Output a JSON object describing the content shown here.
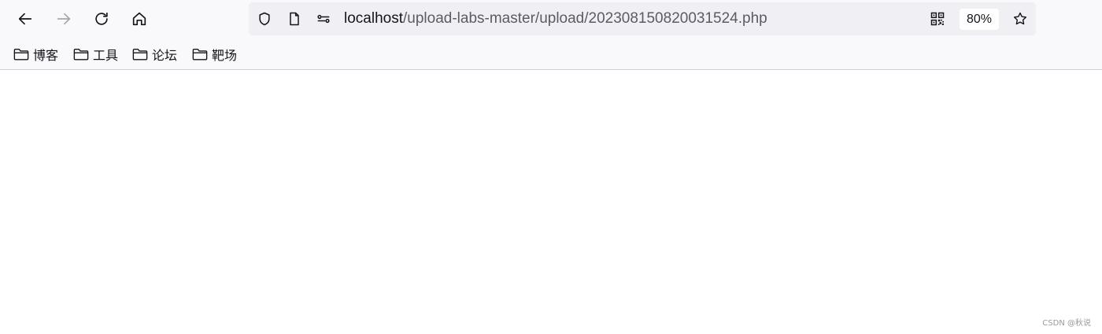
{
  "toolbar": {
    "icons": [
      "arrow-left-icon",
      "arrow-right-icon",
      "reload-icon",
      "home-icon"
    ]
  },
  "urlbar": {
    "icons": [
      "shield-icon",
      "page-icon",
      "permissions-icon",
      "qr-code-icon",
      "star-icon"
    ],
    "host": "localhost",
    "path": "/upload-labs-master/upload/202308150820031524.php",
    "zoom": "80%"
  },
  "bookmarks": [
    {
      "label": "博客",
      "icon": "folder-icon"
    },
    {
      "label": "工具",
      "icon": "folder-icon"
    },
    {
      "label": "论坛",
      "icon": "folder-icon"
    },
    {
      "label": "靶场",
      "icon": "folder-icon"
    }
  ],
  "watermark": "CSDN @秋说",
  "colors": {
    "chrome_bg": "#f9f9fb",
    "urlbar_bg": "#f0f0f4",
    "text": "#15141a",
    "muted_text": "#5b5b66",
    "disabled_icon": "#a6a6ad"
  }
}
